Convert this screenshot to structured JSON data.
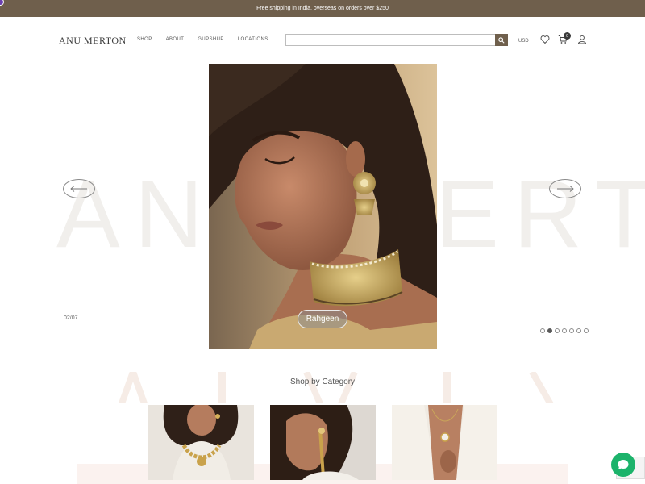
{
  "announcement": {
    "text": "Free shipping in India, overseas on orders over $250"
  },
  "header": {
    "logo": "ANU MERTON",
    "nav": [
      "SHOP",
      "ABOUT",
      "GUPSHUP",
      "LOCATIONS"
    ],
    "search_placeholder": "",
    "currency": "USD",
    "cart_count": "0"
  },
  "hero": {
    "background_text": "ANU MERTON",
    "slide_counter": "02/07",
    "badge": "Rahgeen",
    "total_slides": 7,
    "active_slide": 2
  },
  "categories": {
    "title": "Shop by Category"
  },
  "colors": {
    "brand": "#6f5f4c",
    "chat": "#1cb36b"
  }
}
